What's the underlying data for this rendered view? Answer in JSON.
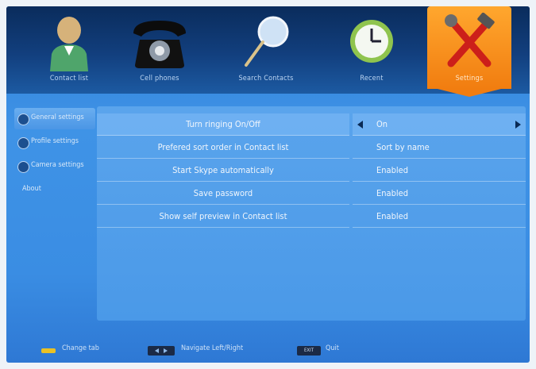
{
  "tabs": [
    {
      "label": "Contact list",
      "icon": "person-icon"
    },
    {
      "label": "Cell phones",
      "icon": "telephone-icon"
    },
    {
      "label": "Search Contacts",
      "icon": "magnifier-icon"
    },
    {
      "label": "Recent",
      "icon": "clock-icon"
    },
    {
      "label": "Settings",
      "icon": "tools-icon",
      "active": true
    }
  ],
  "sidebar": {
    "items": [
      {
        "label": "General settings",
        "active": true
      },
      {
        "label": "Profile settings"
      },
      {
        "label": "Camera settings"
      },
      {
        "label": "About"
      }
    ]
  },
  "settings": {
    "rows": [
      {
        "name": "Turn ringing On/Off",
        "value": "On",
        "active": true
      },
      {
        "name": "Prefered sort order in Contact list",
        "value": "Sort by name"
      },
      {
        "name": "Start Skype automatically",
        "value": "Enabled"
      },
      {
        "name": "Save password",
        "value": "Enabled"
      },
      {
        "name": "Show self preview in Contact list",
        "value": "Enabled"
      }
    ]
  },
  "footer": {
    "change_tab": "Change tab",
    "navigate": "Navigate Left/Right",
    "exit_key": "EXIT",
    "quit": "Quit"
  },
  "colors": {
    "accent_active_tab": "#f17d10",
    "key_yellow": "#e9c125"
  }
}
